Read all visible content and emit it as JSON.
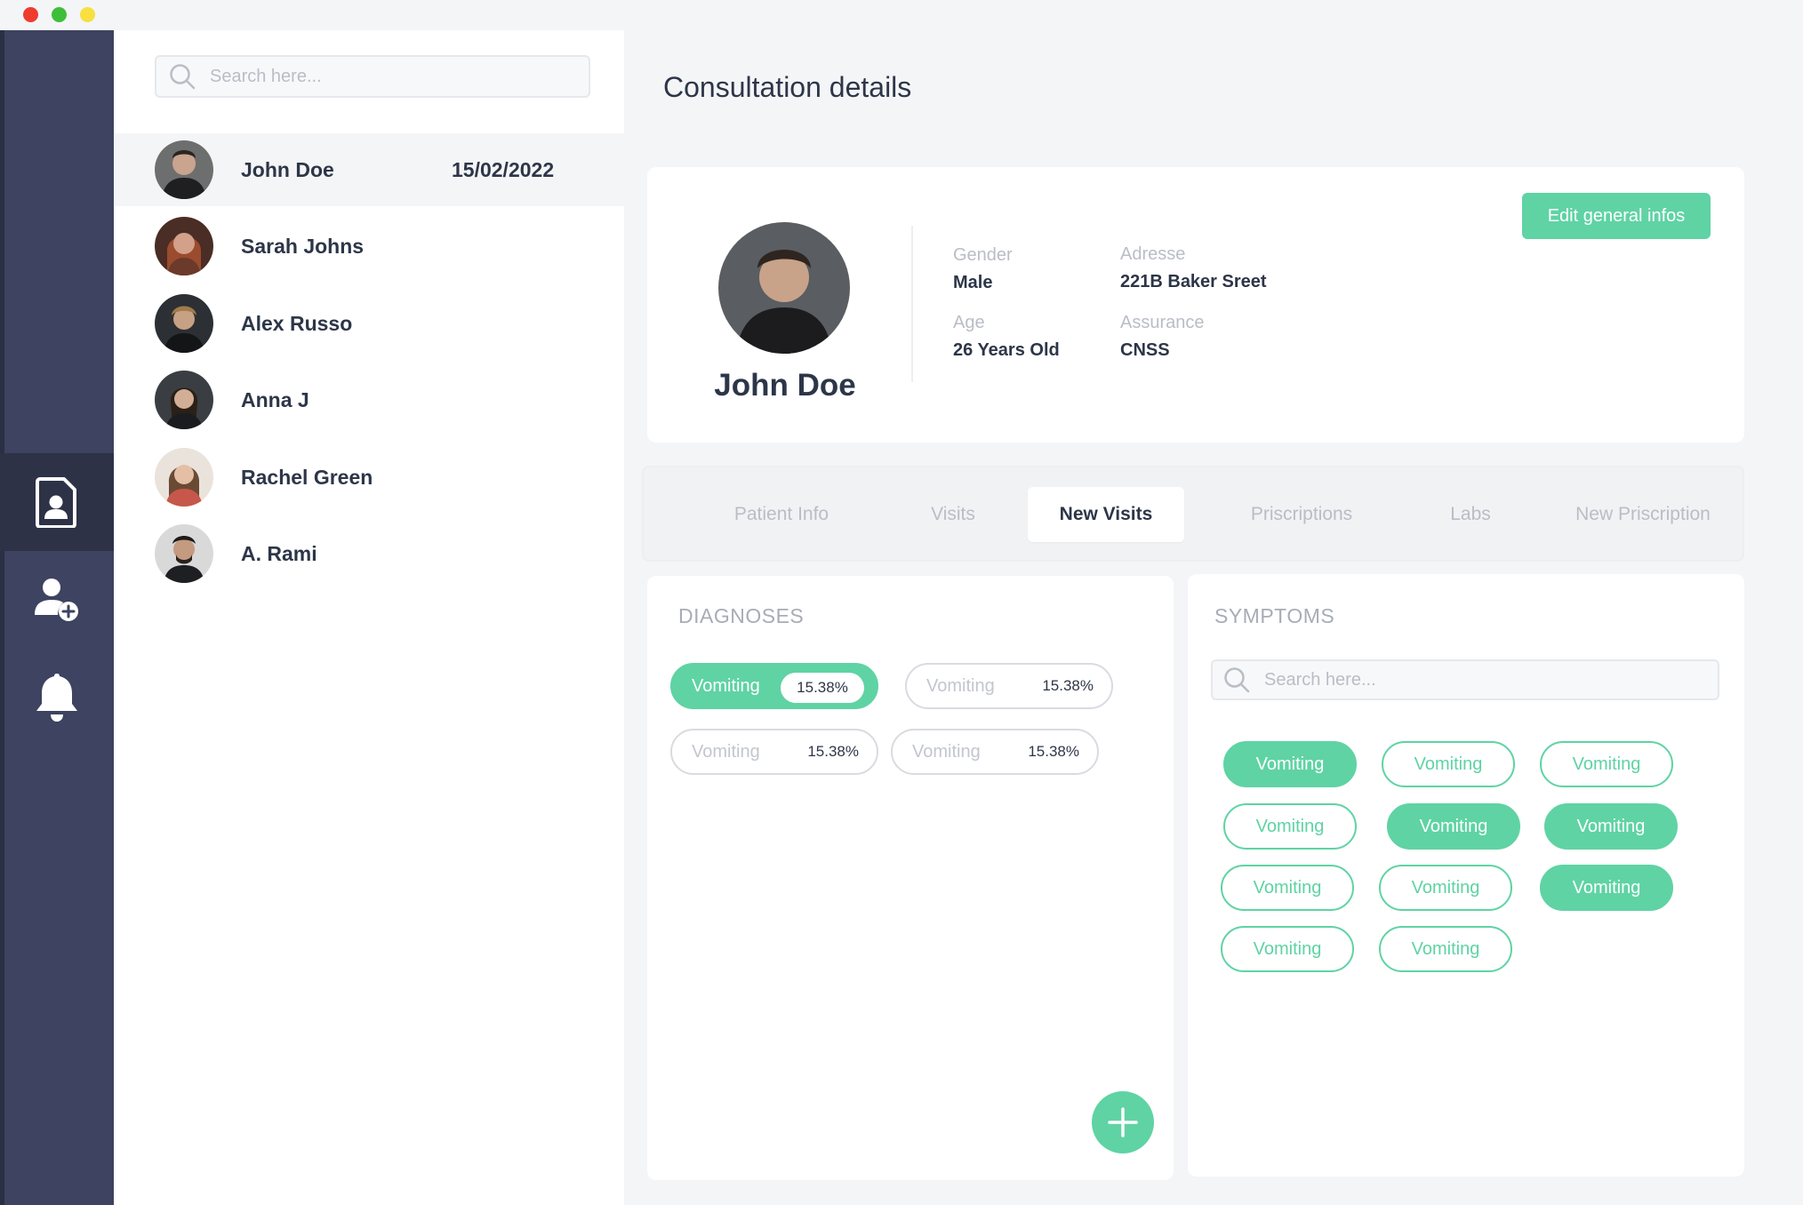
{
  "list": {
    "search_placeholder": "Search here...",
    "patients": [
      {
        "name": "John Doe",
        "date": "15/02/2022"
      },
      {
        "name": "Sarah Johns"
      },
      {
        "name": "Alex Russo"
      },
      {
        "name": "Anna J"
      },
      {
        "name": "Rachel Green"
      },
      {
        "name": "A. Rami"
      }
    ]
  },
  "main": {
    "title": "Consultation details",
    "profile": {
      "name": "John Doe",
      "gender_label": "Gender",
      "gender": "Male",
      "age_label": "Age",
      "age": "26 Years Old",
      "address_label": "Adresse",
      "address": "221B Baker Sreet",
      "assurance_label": "Assurance",
      "assurance": "CNSS",
      "edit_label": "Edit general infos"
    },
    "tabs": [
      "Patient Info",
      "Visits",
      "New Visits",
      "Priscriptions",
      "Labs",
      "New Priscription"
    ],
    "active_tab": "New Visits",
    "diagnoses": {
      "title": "DIAGNOSES",
      "chips": [
        {
          "label": "Vomiting",
          "percent": "15.38%",
          "selected": true
        },
        {
          "label": "Vomiting",
          "percent": "15.38%",
          "selected": false
        },
        {
          "label": "Vomiting",
          "percent": "15.38%",
          "selected": false
        },
        {
          "label": "Vomiting",
          "percent": "15.38%",
          "selected": false
        }
      ]
    },
    "symptoms": {
      "title": "SYMPTOMS",
      "search_placeholder": "Search here...",
      "chips": [
        {
          "label": "Vomiting",
          "selected": true
        },
        {
          "label": "Vomiting",
          "selected": false
        },
        {
          "label": "Vomiting",
          "selected": false
        },
        {
          "label": "Vomiting",
          "selected": false
        },
        {
          "label": "Vomiting",
          "selected": true
        },
        {
          "label": "Vomiting",
          "selected": true
        },
        {
          "label": "Vomiting",
          "selected": false
        },
        {
          "label": "Vomiting",
          "selected": false
        },
        {
          "label": "Vomiting",
          "selected": true
        },
        {
          "label": "Vomiting",
          "selected": false
        },
        {
          "label": "Vomiting",
          "selected": false
        }
      ]
    }
  },
  "colors": {
    "accent": "#5fd3a4",
    "nav_bg": "#3d4360",
    "nav_active": "#2e3247",
    "text": "#2d3648",
    "muted": "#b9bdc6"
  },
  "icons": {
    "nav": [
      "patient-file-icon",
      "add-user-icon",
      "bell-icon"
    ],
    "search": "search-icon",
    "fab": "plus-icon"
  }
}
